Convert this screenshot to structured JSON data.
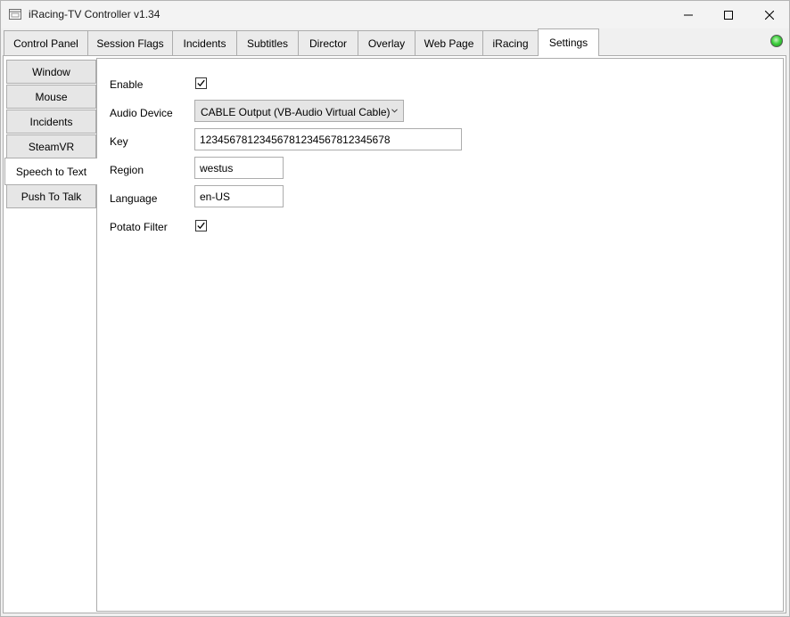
{
  "window": {
    "title": "iRacing-TV Controller v1.34",
    "icon": "app-window-icon",
    "controls": [
      "minimize-icon",
      "maximize-icon",
      "close-icon"
    ]
  },
  "tabs": [
    {
      "label": "Control Panel",
      "active": false
    },
    {
      "label": "Session Flags",
      "active": false
    },
    {
      "label": "Incidents",
      "active": false
    },
    {
      "label": "Subtitles",
      "active": false
    },
    {
      "label": "Director",
      "active": false
    },
    {
      "label": "Overlay",
      "active": false
    },
    {
      "label": "Web Page",
      "active": false
    },
    {
      "label": "iRacing",
      "active": false
    },
    {
      "label": "Settings",
      "active": true
    }
  ],
  "status_indicator": {
    "state": "connected",
    "color": "#3fcf3f"
  },
  "settings_tabs": [
    {
      "label": "Window",
      "active": false
    },
    {
      "label": "Mouse",
      "active": false
    },
    {
      "label": "Incidents",
      "active": false
    },
    {
      "label": "SteamVR",
      "active": false
    },
    {
      "label": "Speech to Text",
      "active": true
    },
    {
      "label": "Push To Talk",
      "active": false
    }
  ],
  "speech_to_text": {
    "enable": {
      "label": "Enable",
      "checked": true
    },
    "audio_device": {
      "label": "Audio Device",
      "value": "CABLE Output (VB-Audio Virtual Cable)"
    },
    "key": {
      "label": "Key",
      "value": "12345678123456781234567812345678"
    },
    "region": {
      "label": "Region",
      "value": "westus"
    },
    "language": {
      "label": "Language",
      "value": "en-US"
    },
    "potato_filter": {
      "label": "Potato Filter",
      "checked": true
    }
  }
}
